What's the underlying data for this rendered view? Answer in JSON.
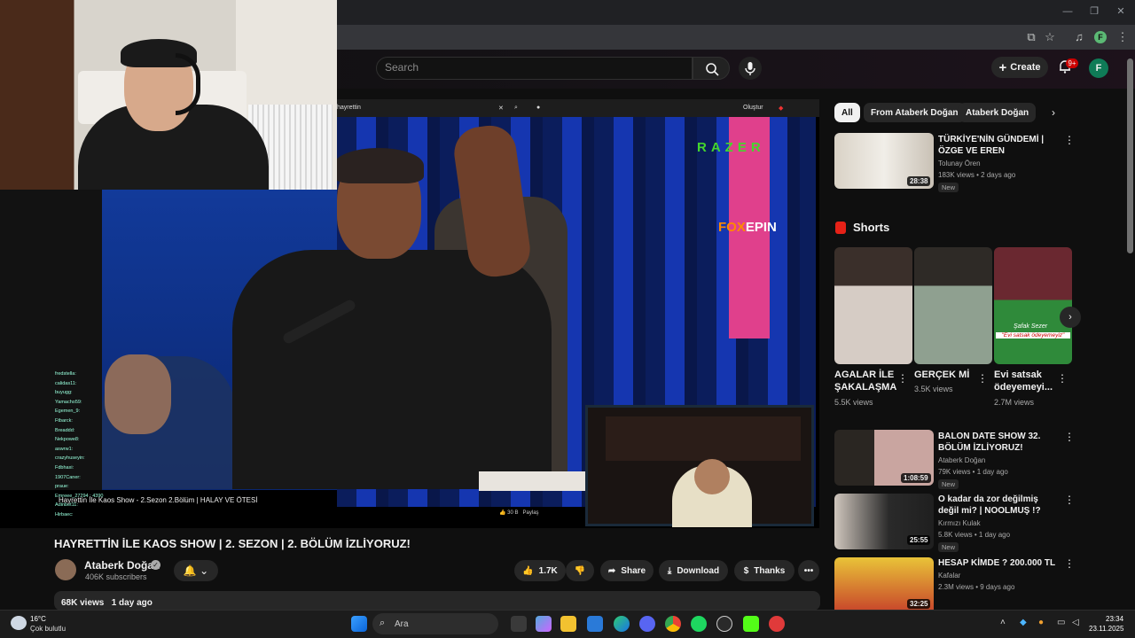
{
  "header": {
    "search_placeholder": "Search",
    "create_label": "Create",
    "notif_count": "9+",
    "avatar_letter": "F",
    "chrome_profile_letter": "F"
  },
  "video_overlay": {
    "inner_search": "hayrettin",
    "inner_create": "Oluştur",
    "razer": "RAZER",
    "foxepin_fox": "FOX",
    "foxepin_rest": "EPIN",
    "inner_caption": "Hayrettin İle Kaos Show - 2.Sezon 2.Bölüm | HALAY VE ÖTESİ",
    "inner_like": "30 B",
    "inner_share": "Paylaş",
    "chat": [
      "fredstella:",
      "calidas11:",
      "buyugg:",
      "Yamacho59:",
      "Egemen_9:",
      "Ftbarck:",
      "Breaddd:",
      "Nekpowe8:",
      "aswrw1:",
      "crazyhuseyin:",
      "Fdbhaxi:",
      "1907Caner:",
      "praue:",
      "Emreee_27294 : 4390",
      "Adinbet11:",
      "Hirbaec:"
    ]
  },
  "video": {
    "title": "HAYRETTİN İLE KAOS SHOW | 2. SEZON | 2. BÖLÜM İZLİYORUZ!",
    "channel": "Ataberk Doğan",
    "subscribers": "406K subscribers",
    "likes": "1.7K",
    "share": "Share",
    "download": "Download",
    "thanks": "Thanks",
    "views": "68K views",
    "age": "1 day ago"
  },
  "chips": [
    "All",
    "From Ataberk Doğan",
    "Ataberk Doğan"
  ],
  "recommendations": [
    {
      "title": "TÜRKİYE'NİN GÜNDEMİ | ÖZGE VE EREN",
      "channel": "Tolunay Ören",
      "meta": "183K views • 2 days ago",
      "duration": "28:38",
      "badge": "New"
    },
    {
      "title": "BALON DATE SHOW 32. BÖLÜM İZLİYORUZ!",
      "channel": "Ataberk Doğan",
      "meta": "79K views • 1 day ago",
      "duration": "1:08:59",
      "badge": "New"
    },
    {
      "title": "O kadar da zor değilmiş değil mi? | NOOLMUŞ !?",
      "channel": "Kırmızı Kulak",
      "meta": "5.8K views • 1 day ago",
      "duration": "25:55",
      "badge": "New"
    },
    {
      "title": "HESAP KİMDE ? 200.000 TL",
      "channel": "Kafalar",
      "meta": "2.3M views • 9 days ago",
      "duration": "32:25",
      "badge": ""
    }
  ],
  "shorts": {
    "heading": "Shorts",
    "items": [
      {
        "title": "AGALAR İLE ŞAKALAŞMA",
        "views": "5.5K views"
      },
      {
        "title": "GERÇEK Mİ",
        "views": "3.5K views"
      },
      {
        "title": "Evi satsak ödeyemeyi...",
        "views": "2.7M views"
      }
    ],
    "overlay_text_1": "Şafak Sezer",
    "overlay_text_2": "\"Evi satsak ödeyemeyiz\""
  },
  "taskbar": {
    "temp": "16°C",
    "weather": "Çok bulutlu",
    "search_placeholder": "Ara",
    "time": "23:34",
    "date": "23.11.2025"
  },
  "colors": {
    "accent": "#cc0000",
    "bg": "#0f0f0f",
    "chip": "#272727"
  }
}
